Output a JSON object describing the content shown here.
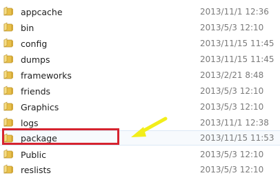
{
  "files": [
    {
      "name": "appcache",
      "date": "2013/11/1 12:36",
      "icon": "folder-icon"
    },
    {
      "name": "bin",
      "date": "2013/5/3 12:10",
      "icon": "folder-icon"
    },
    {
      "name": "config",
      "date": "2013/11/15 11:45",
      "icon": "folder-icon"
    },
    {
      "name": "dumps",
      "date": "2013/11/15 11:45",
      "icon": "folder-icon"
    },
    {
      "name": "frameworks",
      "date": "2013/2/21 8:48",
      "icon": "folder-icon"
    },
    {
      "name": "friends",
      "date": "2013/5/3 12:10",
      "icon": "folder-icon"
    },
    {
      "name": "Graphics",
      "date": "2013/5/3 12:10",
      "icon": "folder-icon"
    },
    {
      "name": "logs",
      "date": "2013/11/1 12:38",
      "icon": "folder-icon"
    },
    {
      "name": "package",
      "date": "2013/11/15 11:53",
      "icon": "folder-icon"
    },
    {
      "name": "Public",
      "date": "2013/5/3 12:10",
      "icon": "folder-icon"
    },
    {
      "name": "reslists",
      "date": "2013/5/3 12:10",
      "icon": "folder-icon"
    }
  ],
  "annotation": {
    "highlight_color": "#d6232f",
    "arrow_color": "#f2ee1a",
    "highlighted_item": "package"
  },
  "colors": {
    "name_text": "#1e1e1e",
    "date_text": "#7a7a7a",
    "folder_body": "#e8c04a",
    "folder_light": "#f6dd86"
  }
}
